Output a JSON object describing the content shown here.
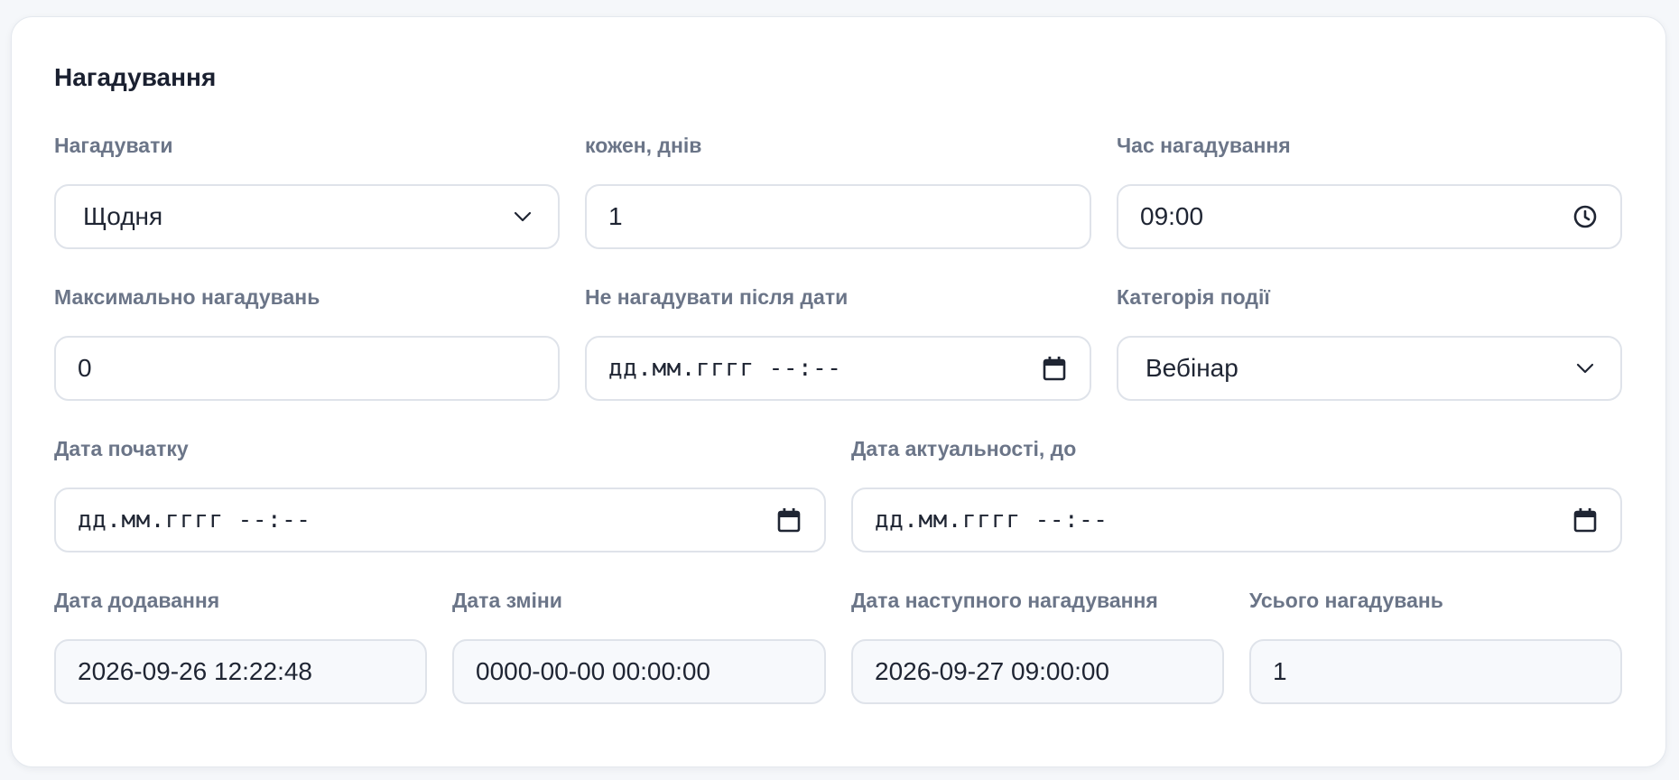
{
  "section": {
    "title": "Нагадування"
  },
  "fields": {
    "remind": {
      "label": "Нагадувати",
      "value": "Щодня",
      "icon": "chevron-down-icon"
    },
    "every_days": {
      "label": "кожен, днів",
      "value": "1"
    },
    "remind_time": {
      "label": "Час нагадування",
      "value": "09:00",
      "icon": "clock-icon"
    },
    "max_reminders": {
      "label": "Максимально нагадувань",
      "value": "0"
    },
    "no_remind_after": {
      "label": "Не нагадувати після дати",
      "placeholder": "дд.мм.гггг --:--",
      "icon": "calendar-icon"
    },
    "event_category": {
      "label": "Категорія події",
      "value": "Вебінар",
      "icon": "chevron-down-icon"
    },
    "start_date": {
      "label": "Дата початку",
      "placeholder": "дд.мм.гггг --:--",
      "icon": "calendar-icon"
    },
    "valid_until": {
      "label": "Дата актуальності, до",
      "placeholder": "дд.мм.гггг --:--",
      "icon": "calendar-icon"
    },
    "date_added": {
      "label": "Дата додавання",
      "value": "2026-09-26 12:22:48"
    },
    "date_modified": {
      "label": "Дата зміни",
      "value": "0000-00-00 00:00:00"
    },
    "next_reminder_date": {
      "label": "Дата наступного нагадування",
      "value": "2026-09-27 09:00:00"
    },
    "total_reminders": {
      "label": "Усього нагадувань",
      "value": "1"
    }
  },
  "colors": {
    "card_background": "#ffffff",
    "page_background": "#f5f7fa",
    "label_text": "#6b7588",
    "title_text": "#1a2030",
    "field_border": "#dfe3ea",
    "readonly_background": "#f7f9fc"
  }
}
